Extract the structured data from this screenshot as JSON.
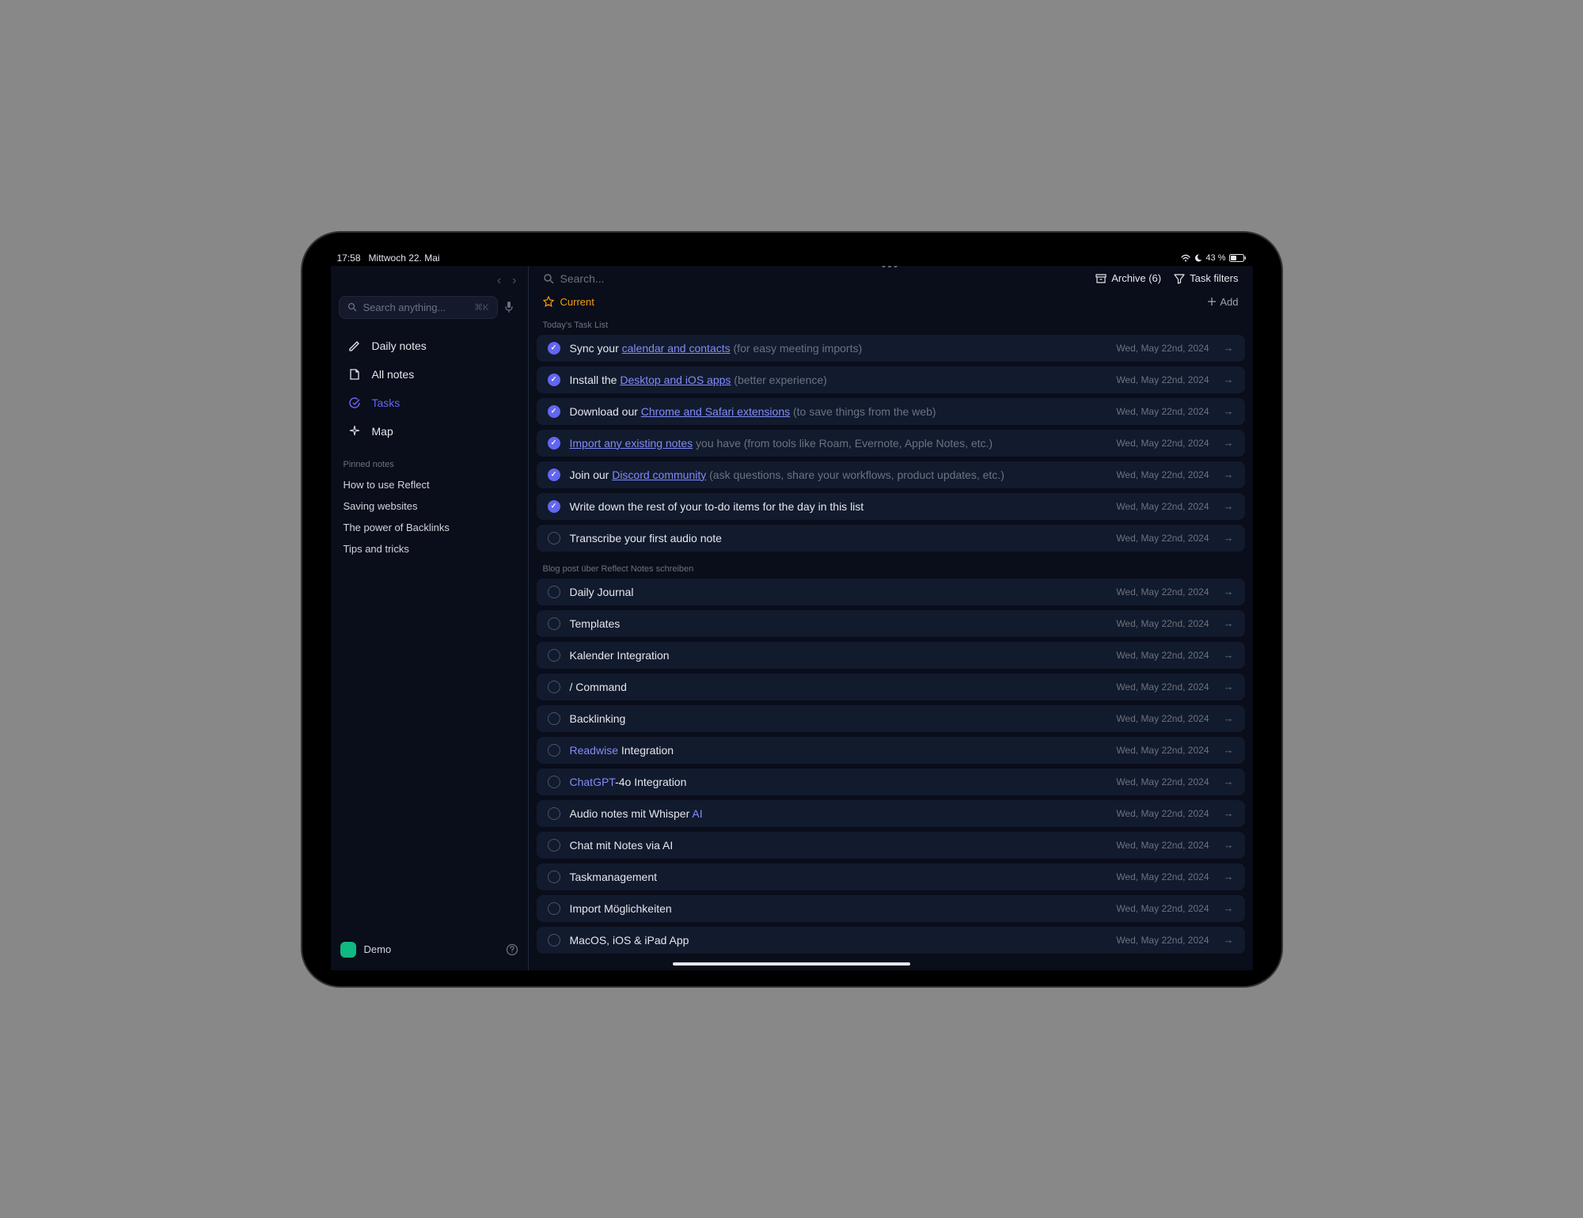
{
  "status": {
    "time": "17:58",
    "date": "Mittwoch 22. Mai",
    "battery": "43 %"
  },
  "sidebar": {
    "search_placeholder": "Search anything...",
    "shortcut": "⌘K",
    "nav": {
      "daily": "Daily notes",
      "all": "All notes",
      "tasks": "Tasks",
      "map": "Map"
    },
    "pinned_label": "Pinned notes",
    "pinned": [
      "How to use Reflect",
      "Saving websites",
      "The power of Backlinks",
      "Tips and tricks"
    ],
    "workspace": "Demo"
  },
  "toolbar": {
    "search_placeholder": "Search...",
    "archive": "Archive (6)",
    "filters": "Task filters"
  },
  "subbar": {
    "current": "Current",
    "add": "Add"
  },
  "sections": {
    "s1": "Today's Task List",
    "s2": "Blog post über Reflect Notes schreiben"
  },
  "date_label": "Wed, May 22nd, 2024",
  "tasks1": [
    {
      "done": true,
      "parts": [
        {
          "t": "Sync your "
        },
        {
          "t": "calendar and contacts",
          "c": "link"
        },
        {
          "t": " (for easy meeting imports)",
          "c": "dim"
        }
      ]
    },
    {
      "done": true,
      "parts": [
        {
          "t": "Install the "
        },
        {
          "t": "Desktop and iOS apps",
          "c": "link"
        },
        {
          "t": " (better experience)",
          "c": "dim"
        }
      ]
    },
    {
      "done": true,
      "parts": [
        {
          "t": "Download our "
        },
        {
          "t": "Chrome and Safari extensions",
          "c": "link"
        },
        {
          "t": " (to save things from the web)",
          "c": "dim"
        }
      ]
    },
    {
      "done": true,
      "parts": [
        {
          "t": "Import any existing notes",
          "c": "link"
        },
        {
          "t": " you have (from tools like Roam, Evernote, Apple Notes, etc.)",
          "c": "dim"
        }
      ]
    },
    {
      "done": true,
      "parts": [
        {
          "t": "Join our "
        },
        {
          "t": "Discord community",
          "c": "link"
        },
        {
          "t": " (ask questions, share your workflows, product updates, etc.)",
          "c": "dim"
        }
      ]
    },
    {
      "done": true,
      "parts": [
        {
          "t": "Write down the rest of your to-do items for the day in this list"
        }
      ]
    },
    {
      "done": false,
      "parts": [
        {
          "t": "Transcribe your first audio note"
        }
      ]
    }
  ],
  "tasks2": [
    {
      "done": false,
      "parts": [
        {
          "t": "Daily Journal"
        }
      ]
    },
    {
      "done": false,
      "parts": [
        {
          "t": "Templates"
        }
      ]
    },
    {
      "done": false,
      "parts": [
        {
          "t": "Kalender Integration"
        }
      ]
    },
    {
      "done": false,
      "parts": [
        {
          "t": "/ Command"
        }
      ]
    },
    {
      "done": false,
      "parts": [
        {
          "t": "Backlinking"
        }
      ]
    },
    {
      "done": false,
      "parts": [
        {
          "t": "Readwise",
          "c": "accent"
        },
        {
          "t": " Integration"
        }
      ]
    },
    {
      "done": false,
      "parts": [
        {
          "t": "ChatGPT",
          "c": "accent"
        },
        {
          "t": "-4o Integration"
        }
      ]
    },
    {
      "done": false,
      "parts": [
        {
          "t": "Audio notes mit Whisper "
        },
        {
          "t": "AI",
          "c": "accent"
        }
      ]
    },
    {
      "done": false,
      "parts": [
        {
          "t": "Chat mit Notes via AI"
        }
      ]
    },
    {
      "done": false,
      "parts": [
        {
          "t": "Taskmanagement"
        }
      ]
    },
    {
      "done": false,
      "parts": [
        {
          "t": "Import Möglichkeiten"
        }
      ]
    },
    {
      "done": false,
      "parts": [
        {
          "t": "MacOS, iOS & iPad App"
        }
      ]
    }
  ]
}
